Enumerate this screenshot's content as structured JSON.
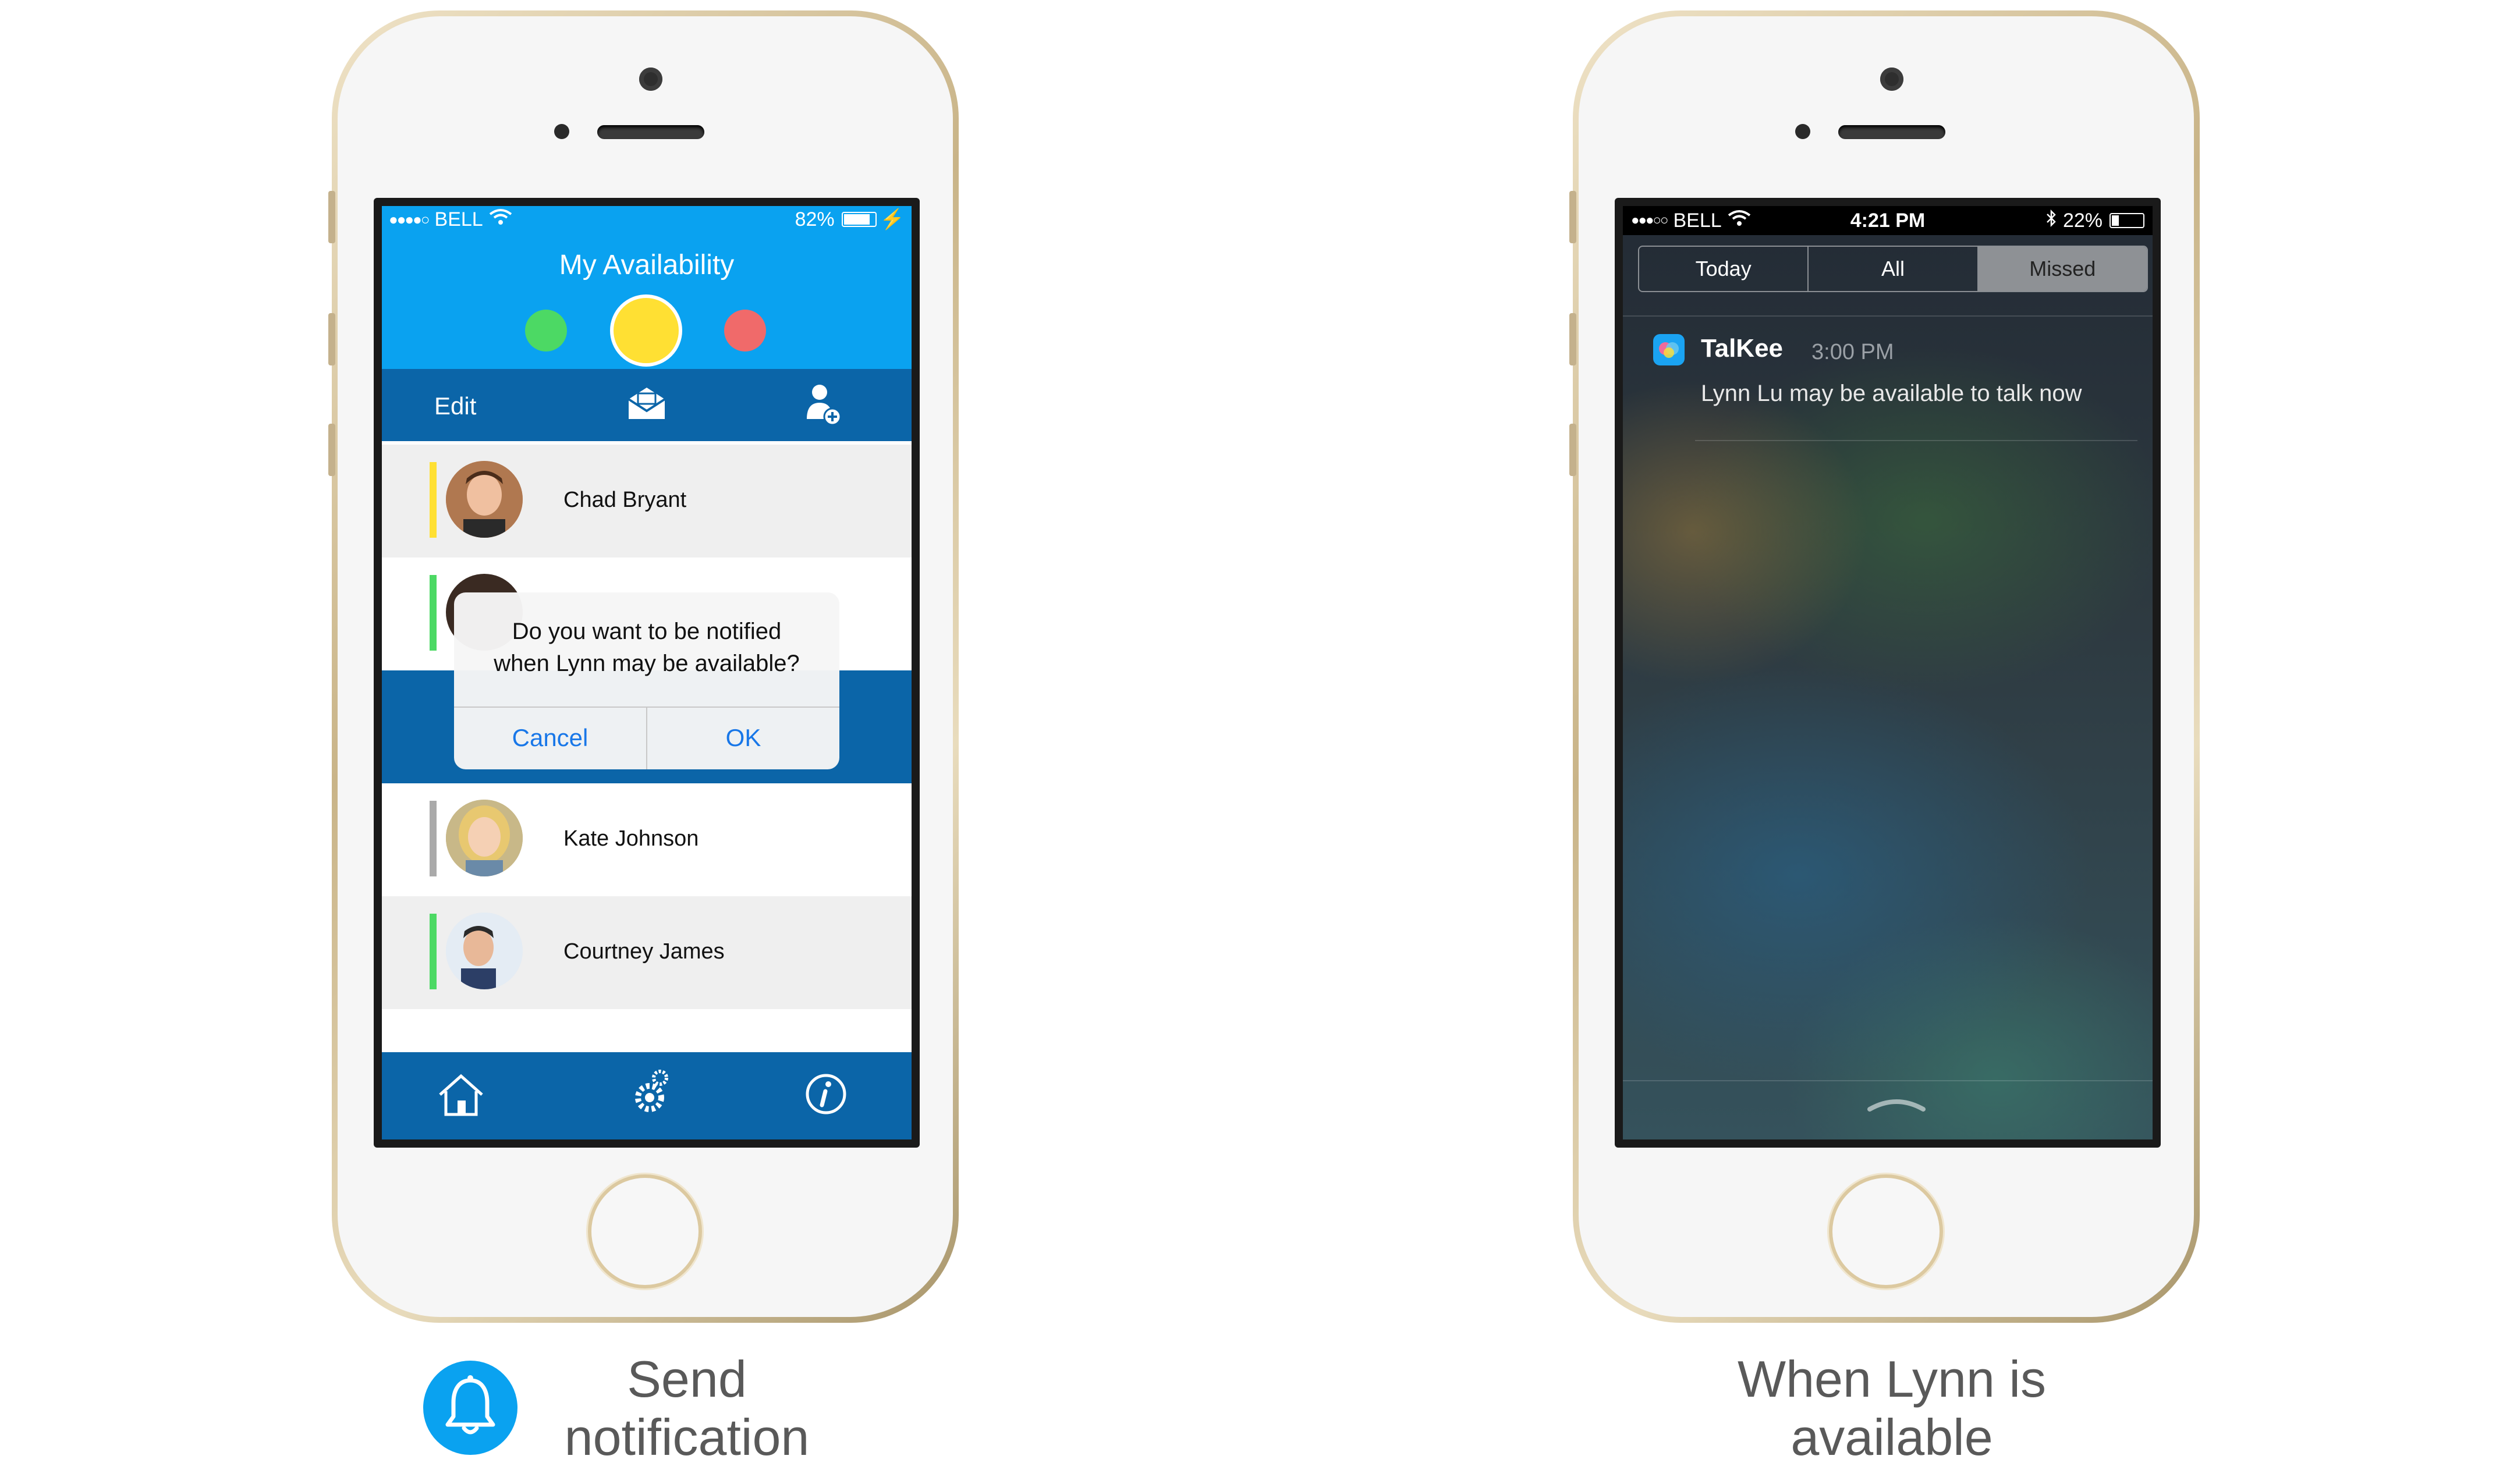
{
  "left_phone": {
    "status_bar": {
      "carrier": "BELL",
      "battery": "82%"
    },
    "app_title": "My Availability",
    "availability_dots": {
      "available_color": "#4cd964",
      "maybe_color": "#ffe033",
      "busy_color": "#f06a6a",
      "selected": "maybe"
    },
    "toolbar": {
      "edit_label": "Edit",
      "icons": [
        "mail-icon",
        "add-contact-icon"
      ]
    },
    "contacts": [
      {
        "name": "Chad Bryant",
        "status_color": "#ffe033"
      },
      {
        "name": "",
        "status_color": "#4cd964"
      },
      {
        "name": "Kate Johnson",
        "status_color": "#aaaaaa"
      },
      {
        "name": "Courtney James",
        "status_color": "#4cd964"
      }
    ],
    "alert": {
      "message_line1": "Do you want to be notified",
      "message_line2": "when Lynn may be available?",
      "cancel_label": "Cancel",
      "ok_label": "OK"
    },
    "tab_bar": [
      "home-icon",
      "settings-icon",
      "info-icon"
    ]
  },
  "right_phone": {
    "status_bar": {
      "carrier": "BELL",
      "time": "4:21 PM",
      "battery": "22%"
    },
    "segments": [
      "Today",
      "All",
      "Missed"
    ],
    "selected_segment": "Missed",
    "notification": {
      "app_name": "TalKee",
      "time": "3:00 PM",
      "message": "Lynn Lu may be available to talk now"
    }
  },
  "captions": {
    "left_line1": "Send",
    "left_line2": "notification",
    "right_line1": "When Lynn is",
    "right_line2": "available"
  }
}
